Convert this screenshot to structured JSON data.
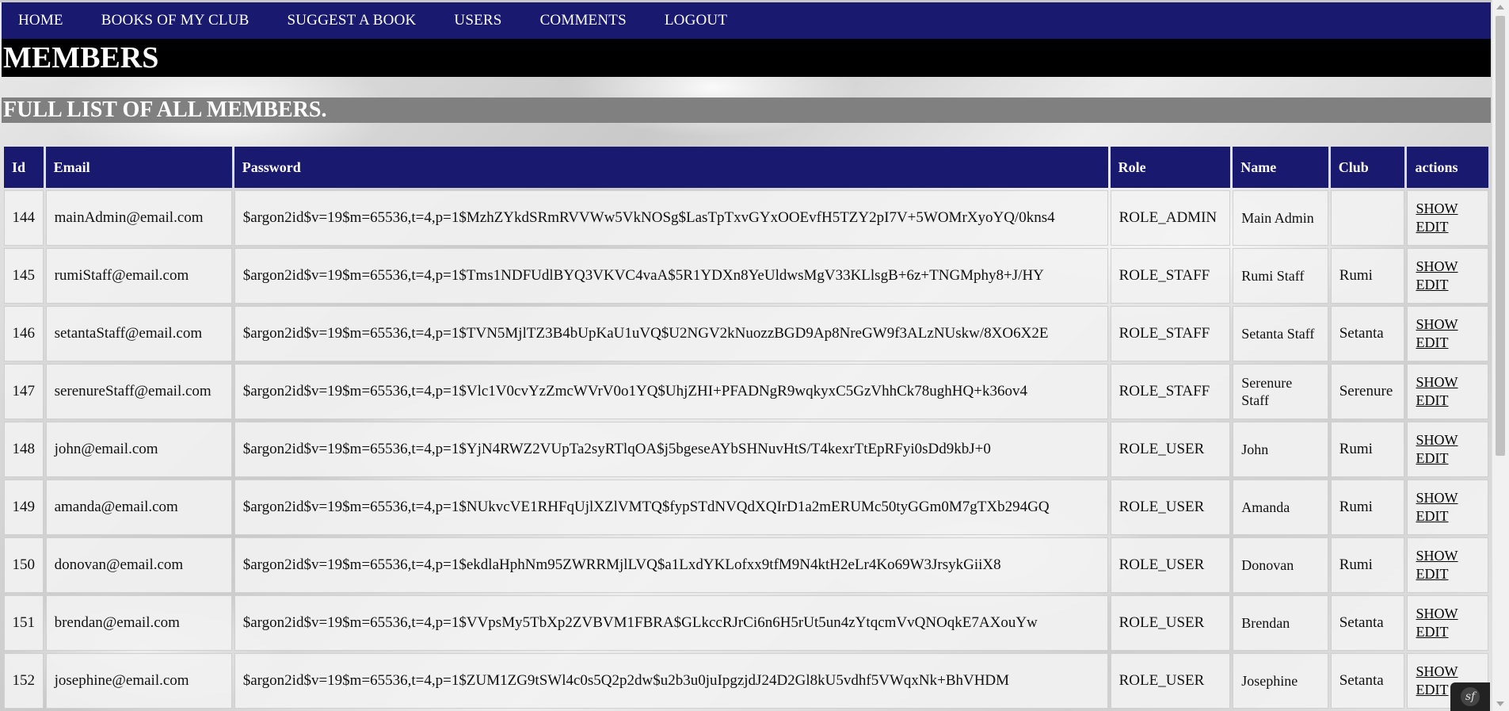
{
  "nav": {
    "items": [
      "HOME",
      "BOOKS OF MY CLUB",
      "SUGGEST A BOOK",
      "USERS",
      "COMMENTS",
      "LOGOUT"
    ]
  },
  "page_title": "MEMBERS",
  "subtitle": "FULL LIST OF ALL MEMBERS.",
  "table": {
    "headers": [
      "Id",
      "Email",
      "Password",
      "Role",
      "Name",
      "Club",
      "actions"
    ],
    "rows": [
      {
        "id": "144",
        "email": "mainAdmin@email.com",
        "password": "$argon2id$v=19$m=65536,t=4,p=1$MzhZYkdSRmRVVWw5VkNOSg$LasTpTxvGYxOOEvfH5TZY2pI7V+5WOMrXyoYQ/0kns4",
        "role": "ROLE_ADMIN",
        "name": "Main Admin",
        "club": "",
        "show": "SHOW",
        "edit": "EDIT"
      },
      {
        "id": "145",
        "email": "rumiStaff@email.com",
        "password": "$argon2id$v=19$m=65536,t=4,p=1$Tms1NDFUdlBYQ3VKVC4vaA$5R1YDXn8YeUldwsMgV33KLlsgB+6z+TNGMphy8+J/HY",
        "role": "ROLE_STAFF",
        "name": "Rumi Staff",
        "club": "Rumi",
        "show": "SHOW",
        "edit": "EDIT"
      },
      {
        "id": "146",
        "email": "setantaStaff@email.com",
        "password": "$argon2id$v=19$m=65536,t=4,p=1$TVN5MjlTZ3B4bUpKaU1uVQ$U2NGV2kNuozzBGD9Ap8NreGW9f3ALzNUskw/8XO6X2E",
        "role": "ROLE_STAFF",
        "name": "Setanta Staff",
        "club": "Setanta",
        "show": "SHOW",
        "edit": "EDIT"
      },
      {
        "id": "147",
        "email": "serenureStaff@email.com",
        "password": "$argon2id$v=19$m=65536,t=4,p=1$Vlc1V0cvYzZmcWVrV0o1YQ$UhjZHI+PFADNgR9wqkyxC5GzVhhCk78ughHQ+k36ov4",
        "role": "ROLE_STAFF",
        "name": "Serenure Staff",
        "club": "Serenure",
        "show": "SHOW",
        "edit": "EDIT"
      },
      {
        "id": "148",
        "email": "john@email.com",
        "password": "$argon2id$v=19$m=65536,t=4,p=1$YjN4RWZ2VUpTa2syRTlqOA$j5bgeseAYbSHNuvHtS/T4kexrTtEpRFyi0sDd9kbJ+0",
        "role": "ROLE_USER",
        "name": "John",
        "club": "Rumi",
        "show": "SHOW",
        "edit": "EDIT"
      },
      {
        "id": "149",
        "email": "amanda@email.com",
        "password": "$argon2id$v=19$m=65536,t=4,p=1$NUkvcVE1RHFqUjlXZlVMTQ$fypSTdNVQdXQIrD1a2mERUMc50tyGGm0M7gTXb294GQ",
        "role": "ROLE_USER",
        "name": "Amanda",
        "club": "Rumi",
        "show": "SHOW",
        "edit": "EDIT"
      },
      {
        "id": "150",
        "email": "donovan@email.com",
        "password": "$argon2id$v=19$m=65536,t=4,p=1$ekdlaHphNm95ZWRRMjlLVQ$a1LxdYKLofxx9tfM9N4ktH2eLr4Ko69W3JrsykGiiX8",
        "role": "ROLE_USER",
        "name": "Donovan",
        "club": "Rumi",
        "show": "SHOW",
        "edit": "EDIT"
      },
      {
        "id": "151",
        "email": "brendan@email.com",
        "password": "$argon2id$v=19$m=65536,t=4,p=1$VVpsMy5TbXp2ZVBVM1FBRA$GLkccRJrCi6n6H5rUt5un4zYtqcmVvQNOqkE7AXouYw",
        "role": "ROLE_USER",
        "name": "Brendan",
        "club": "Setanta",
        "show": "SHOW",
        "edit": "EDIT"
      },
      {
        "id": "152",
        "email": "josephine@email.com",
        "password": "$argon2id$v=19$m=65536,t=4,p=1$ZUM1ZG9tSWl4c0s5Q2p2dw$u2b3u0juIpgzjdJ24D2Gl8kU5vdhf5VWqxNk+BhVHDM",
        "role": "ROLE_USER",
        "name": "Josephine",
        "club": "Setanta",
        "show": "SHOW",
        "edit": "EDIT"
      }
    ]
  }
}
